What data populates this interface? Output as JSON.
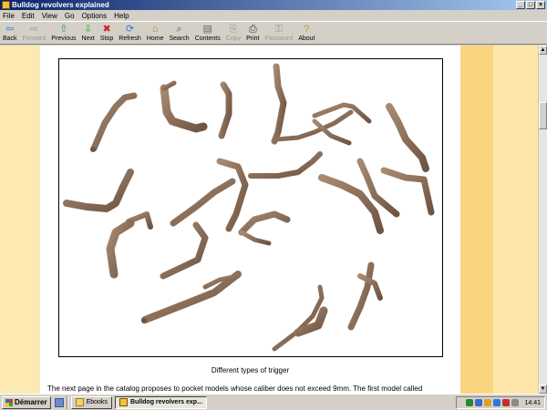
{
  "window": {
    "title": "Bulldog revolvers explained",
    "controls": [
      "_",
      "□",
      "×"
    ]
  },
  "menu": [
    "File",
    "Edit",
    "View",
    "Go",
    "Options",
    "Help"
  ],
  "toolbar": [
    {
      "label": "Back",
      "icon": "arrow-left-icon",
      "glyph": "⇦",
      "color": "#2f7fd8",
      "enabled": true
    },
    {
      "label": "Forward",
      "icon": "arrow-right-icon",
      "glyph": "⇨",
      "color": "#9a9890",
      "enabled": false
    },
    {
      "label": "Previous",
      "icon": "arrow-up-icon",
      "glyph": "⇧",
      "color": "#2fa72f",
      "enabled": true
    },
    {
      "label": "Next",
      "icon": "arrow-down-icon",
      "glyph": "⇩",
      "color": "#2fa72f",
      "enabled": true
    },
    {
      "label": "Stop",
      "icon": "stop-icon",
      "glyph": "✖",
      "color": "#d32020",
      "enabled": true
    },
    {
      "label": "Refresh",
      "icon": "refresh-icon",
      "glyph": "⟳",
      "color": "#2f7fd8",
      "enabled": true
    },
    {
      "label": "Home",
      "icon": "home-icon",
      "glyph": "⌂",
      "color": "#b0772a",
      "enabled": true
    },
    {
      "label": "Search",
      "icon": "search-icon",
      "glyph": "⌕",
      "color": "#2f4f8f",
      "enabled": true
    },
    {
      "label": "Contents",
      "icon": "contents-icon",
      "glyph": "▤",
      "color": "#5a6a7a",
      "enabled": true
    },
    {
      "label": "Copy",
      "icon": "copy-icon",
      "glyph": "⎘",
      "color": "#9a9890",
      "enabled": false
    },
    {
      "label": "Print",
      "icon": "print-icon",
      "glyph": "⎙",
      "color": "#404040",
      "enabled": true
    },
    {
      "label": "Password",
      "icon": "key-icon",
      "glyph": "⚿",
      "color": "#9a9890",
      "enabled": false
    },
    {
      "label": "About",
      "icon": "about-icon",
      "glyph": "?",
      "color": "#c8a020",
      "enabled": true
    }
  ],
  "content": {
    "image_subject": "Different types of trigger",
    "caption": "Different types of trigger",
    "body_text": "The next page in the catalog proposes to pocket models whose caliber does not exceed 9mm. The first model called"
  },
  "taskbar": {
    "start_label": "Démarrer",
    "tasks": [
      {
        "label": "Ebooks",
        "active": false
      },
      {
        "label": "Bulldog revolvers exp...",
        "active": true
      }
    ],
    "clock": "14:41"
  },
  "colors": {
    "page_bg": "#ffffff",
    "band_left": "#fdeab2",
    "band_right_dark": "#fad580",
    "band_right_light": "#fde6a8",
    "titlebar": "#0a246a",
    "trigger_metal": "#8a6a52"
  }
}
